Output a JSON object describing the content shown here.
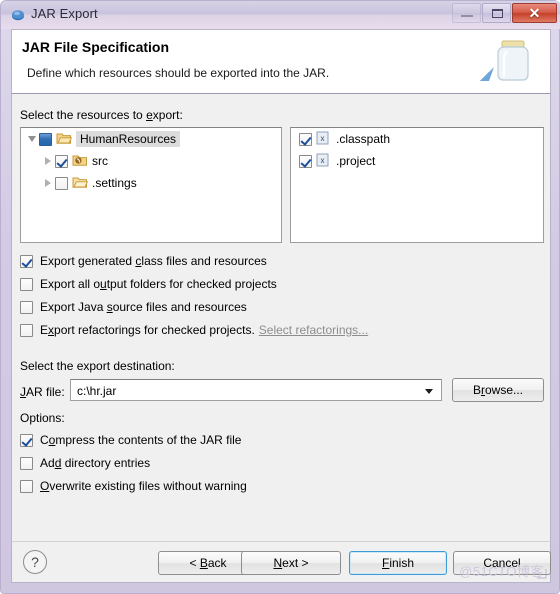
{
  "window": {
    "title": "JAR Export",
    "icon": "jar-export-icon",
    "buttons": {
      "minimize": "minimize-button",
      "maximize": "maximize-button",
      "close": "✕"
    }
  },
  "header": {
    "title": "JAR File Specification",
    "subtitle": "Define which resources should be exported into the JAR.",
    "icon": "jar-banner-icon"
  },
  "resources": {
    "label_pre": "Select the resources to ",
    "label_mn": "e",
    "label_post": "xport:",
    "tree": [
      {
        "label": "HumanResources",
        "state": "grayed",
        "expanded": true,
        "depth": 0,
        "icon": "project-folder-icon",
        "selected": true
      },
      {
        "label": "src",
        "state": "checked",
        "expanded": false,
        "depth": 1,
        "icon": "source-folder-icon",
        "selected": false
      },
      {
        "label": ".settings",
        "state": "unchecked",
        "expanded": false,
        "depth": 1,
        "icon": "folder-icon",
        "selected": false
      }
    ],
    "files": [
      {
        "label": ".classpath",
        "state": "checked",
        "icon": "xml-file-icon"
      },
      {
        "label": ".project",
        "state": "checked",
        "icon": "xml-file-icon"
      }
    ]
  },
  "export_options": [
    {
      "pre": "Export generated ",
      "mn": "c",
      "post": "lass files and resources",
      "state": "checked"
    },
    {
      "pre": "Export all o",
      "mn": "u",
      "post": "tput folders for checked projects",
      "state": "unchecked"
    },
    {
      "pre": "Export Java ",
      "mn": "s",
      "post": "ource files and resources",
      "state": "unchecked"
    },
    {
      "pre": "E",
      "mn": "x",
      "post": "port refactorings for checked projects.",
      "state": "unchecked",
      "link": "Select refactorings..."
    }
  ],
  "destination": {
    "section_label": "Select the export destination:",
    "field_pre": "",
    "field_mn": "J",
    "field_post": "AR file:",
    "value": "c:\\hr.jar",
    "placeholder": "",
    "browse_pre": "B",
    "browse_mn": "r",
    "browse_post": "owse..."
  },
  "options": {
    "section_label": "Options:",
    "items": [
      {
        "pre": "C",
        "mn": "o",
        "post": "mpress the contents of the JAR file",
        "state": "checked"
      },
      {
        "pre": "Ad",
        "mn": "d",
        "post": " directory entries",
        "state": "unchecked"
      },
      {
        "pre": "",
        "mn": "O",
        "post": "verwrite existing files without warning",
        "state": "unchecked"
      }
    ]
  },
  "footer": {
    "help": "?",
    "buttons": [
      {
        "pre": "< ",
        "mn": "B",
        "post": "ack",
        "focus": false,
        "name": "back-button"
      },
      {
        "pre": "",
        "mn": "N",
        "post": "ext >",
        "focus": false,
        "name": "next-button"
      },
      {
        "pre": "",
        "mn": "F",
        "post": "inish",
        "focus": true,
        "name": "finish-button"
      },
      {
        "pre": "Cancel",
        "mn": "",
        "post": "",
        "focus": false,
        "name": "cancel-button"
      }
    ],
    "watermark": "@51CTO博客"
  },
  "colors": {
    "titlebar": "#cfc6e0",
    "body": "#f0f0f0",
    "accent_focus": "#3c9ad6",
    "close": "#c43f29",
    "check": "#1b4f9c"
  }
}
